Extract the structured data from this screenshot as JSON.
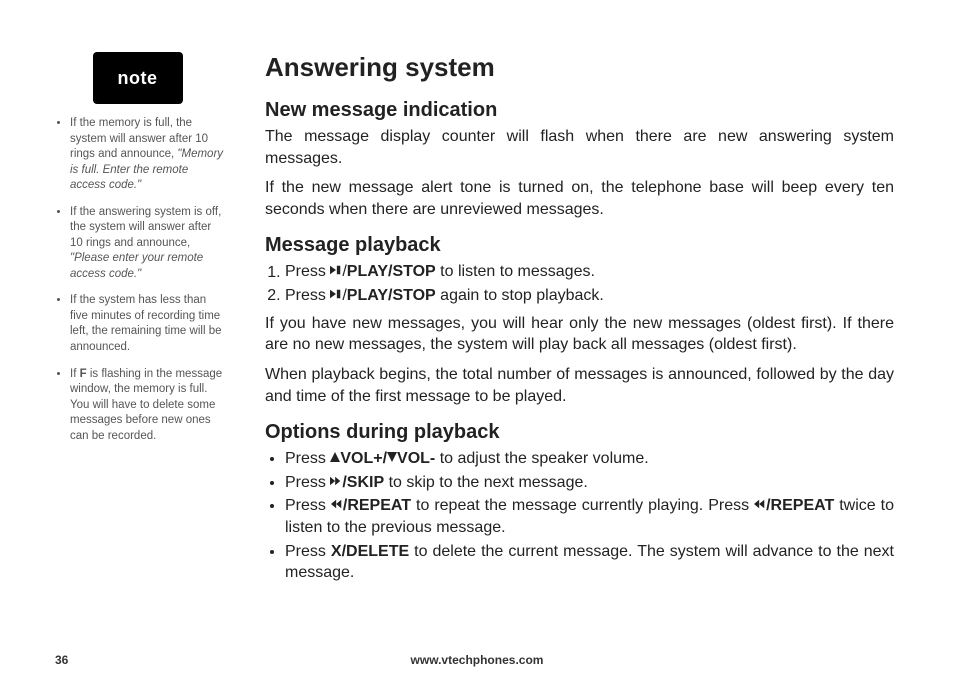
{
  "note_label": "note",
  "sidebar": {
    "items": [
      {
        "pre": "If the memory is full, the system will answer after 10 rings and announce, ",
        "quote": "\"Memory is full. Enter the remote access code.\""
      },
      {
        "pre": "If the answering system is off, the system will answer after 10 rings and announce, ",
        "quote": "\"Please enter your remote access code.\""
      },
      {
        "pre": "If the system has less than five minutes of recording time left, the remaining time will be announced.",
        "quote": ""
      },
      {
        "pre_a": "If ",
        "bold": "F",
        "pre_b": " is flashing in the message window, the memory is full. You will have to delete some messages before new ones can be recorded."
      }
    ]
  },
  "main": {
    "title": "Answering system",
    "sec1": {
      "heading": "New message indication",
      "p1": "The message display counter will flash when there are new answering system messages.",
      "p2": "If the new message alert tone is turned on, the telephone base will beep every ten seconds when there are unreviewed messages."
    },
    "sec2": {
      "heading": "Message playback",
      "li1_pre": "Press ",
      "li1_bold": "PLAY/STOP",
      "li1_post": " to listen to messages.",
      "li2_pre": "Press ",
      "li2_bold": "PLAY/STOP",
      "li2_post": " again to stop playback.",
      "p1": "If you have new messages, you will hear only the new messages (oldest first). If there are no new messages, the system will play back all messages (oldest first).",
      "p2": "When playback begins, the total number of messages is announced, followed by the day and time of the first message to be played."
    },
    "sec3": {
      "heading": "Options during playback",
      "li1_pre": "Press ",
      "li1_b1": "VOL+/",
      "li1_b2": "VOL-",
      "li1_post": " to adjust the speaker volume.",
      "li2_pre": "Press ",
      "li2_bold": "/SKIP",
      "li2_post": " to skip to the next message.",
      "li3_pre": "Press ",
      "li3_b1": "/REPEAT",
      "li3_mid": " to repeat the message currently playing. Press ",
      "li3_b2": "/REPEAT",
      "li3_post": " twice to listen to the previous message.",
      "li4_pre": "Press ",
      "li4_bold": "X/DELETE",
      "li4_post": " to delete the current message. The system will advance to the next message."
    }
  },
  "footer": {
    "page": "36",
    "url": "www.vtechphones.com"
  }
}
